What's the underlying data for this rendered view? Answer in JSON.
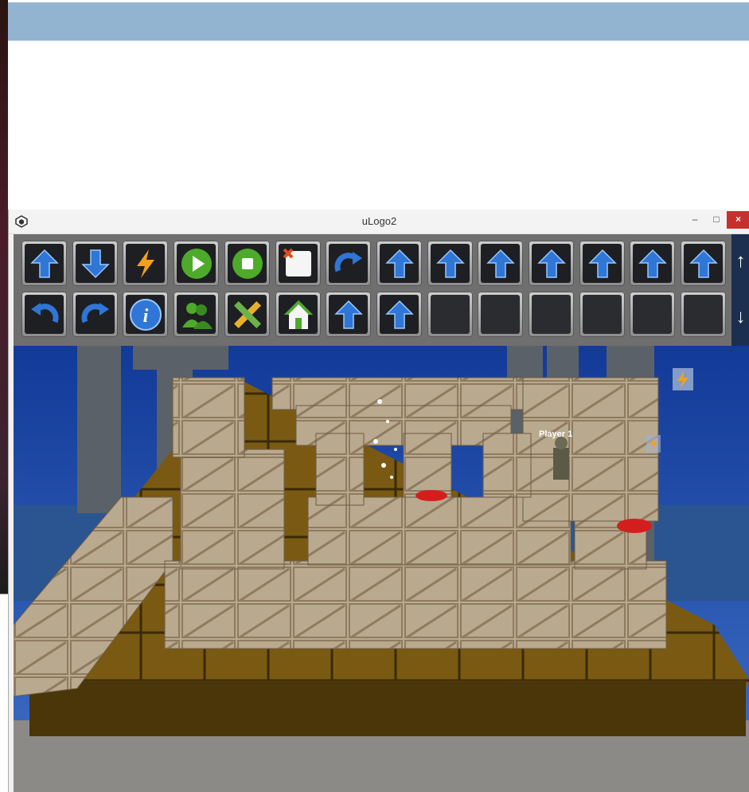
{
  "window": {
    "title": "uLogo2",
    "controls": {
      "minimize": "–",
      "maximize": "□",
      "close": "×"
    }
  },
  "toolbar": {
    "row1": [
      "arrow-up",
      "arrow-down",
      "lightning",
      "play",
      "stop",
      "clear-note",
      "redo",
      "arrow-up",
      "arrow-up",
      "arrow-up",
      "arrow-up",
      "arrow-up",
      "arrow-up",
      "arrow-up"
    ],
    "row2": [
      "undo",
      "redo",
      "info",
      "users",
      "edit-tools",
      "home",
      "arrow-up",
      "arrow-up",
      "empty",
      "empty",
      "empty",
      "empty",
      "empty",
      "empty"
    ]
  },
  "scroll": {
    "up": "↑",
    "down": "↓"
  },
  "scene": {
    "player_label": "Player 1"
  },
  "colors": {
    "accent": "#93b4d1",
    "close": "#c7302b",
    "side": "#1c2f4e"
  }
}
